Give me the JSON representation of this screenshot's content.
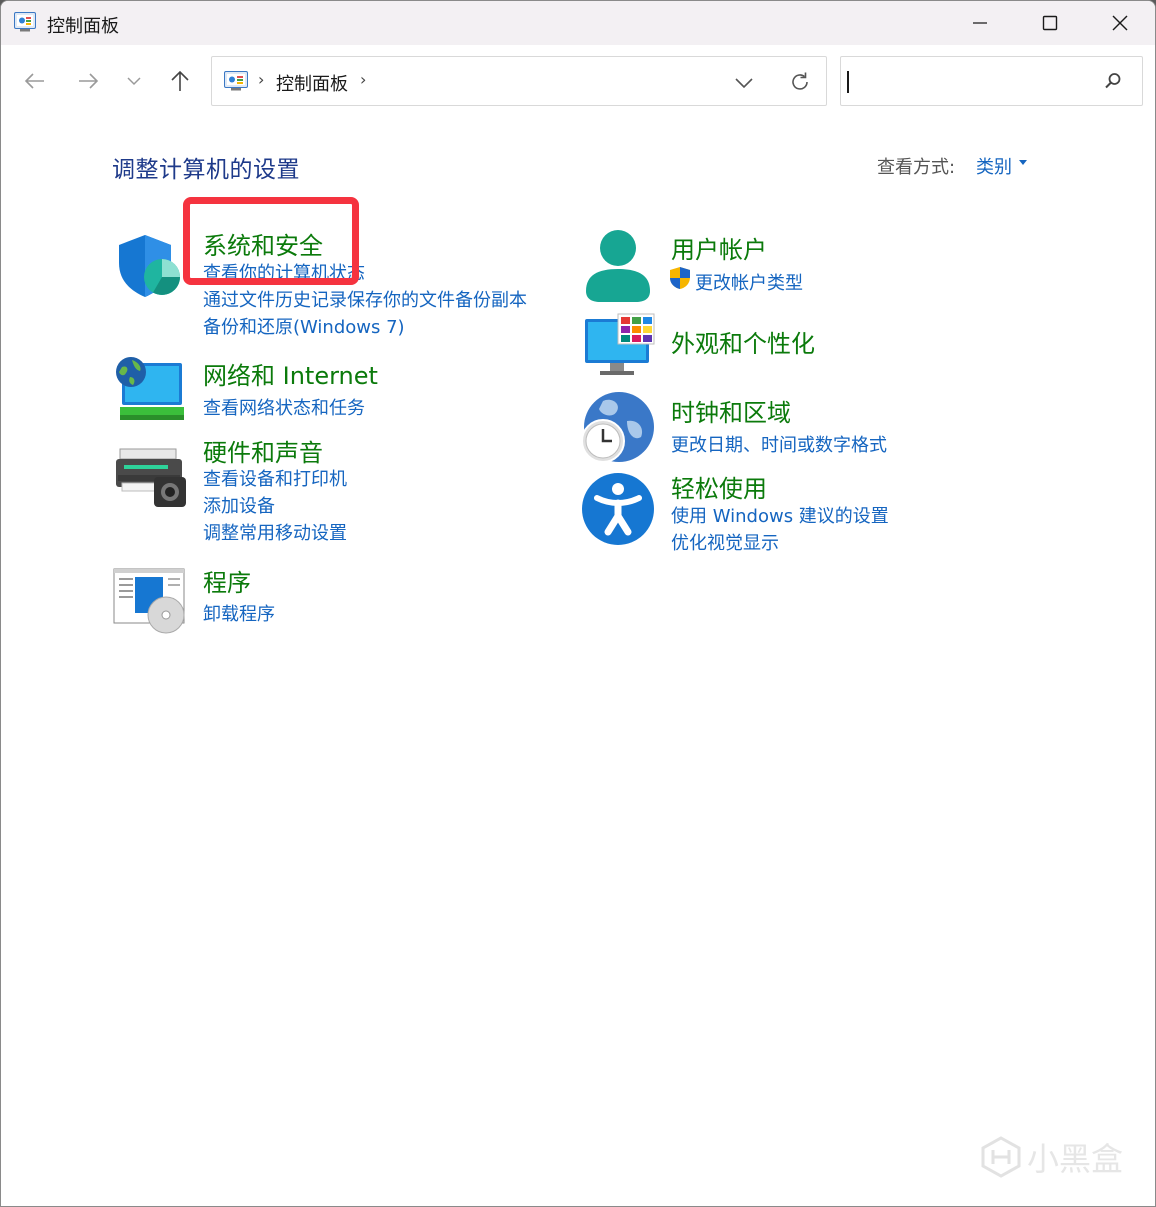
{
  "window": {
    "title": "控制面板"
  },
  "address": {
    "location": "控制面板",
    "separator": "›"
  },
  "search": {
    "placeholder": ""
  },
  "content": {
    "heading": "调整计算机的设置",
    "view_by_label": "查看方式:",
    "view_by_value": "类别"
  },
  "categories": {
    "system_security": {
      "title": "系统和安全",
      "links": [
        "查看你的计算机状态",
        "通过文件历史记录保存你的文件备份副本",
        "备份和还原(Windows 7)"
      ]
    },
    "network": {
      "title": "网络和 Internet",
      "links": [
        "查看网络状态和任务"
      ]
    },
    "hardware": {
      "title": "硬件和声音",
      "links": [
        "查看设备和打印机",
        "添加设备",
        "调整常用移动设置"
      ]
    },
    "programs": {
      "title": "程序",
      "links": [
        "卸载程序"
      ]
    },
    "user_accounts": {
      "title": "用户帐户",
      "links": [
        "更改帐户类型"
      ]
    },
    "appearance": {
      "title": "外观和个性化",
      "links": []
    },
    "clock_region": {
      "title": "时钟和区域",
      "links": [
        "更改日期、时间或数字格式"
      ]
    },
    "ease_of_access": {
      "title": "轻松使用",
      "links": [
        "使用 Windows 建议的设置",
        "优化视觉显示"
      ]
    }
  },
  "watermark": {
    "text": "小黑盒"
  },
  "colors": {
    "title_green": "#0b7a0b",
    "link_blue": "#1565c0",
    "heading_blue": "#1e3a8a",
    "highlight_red": "#f5333f"
  }
}
